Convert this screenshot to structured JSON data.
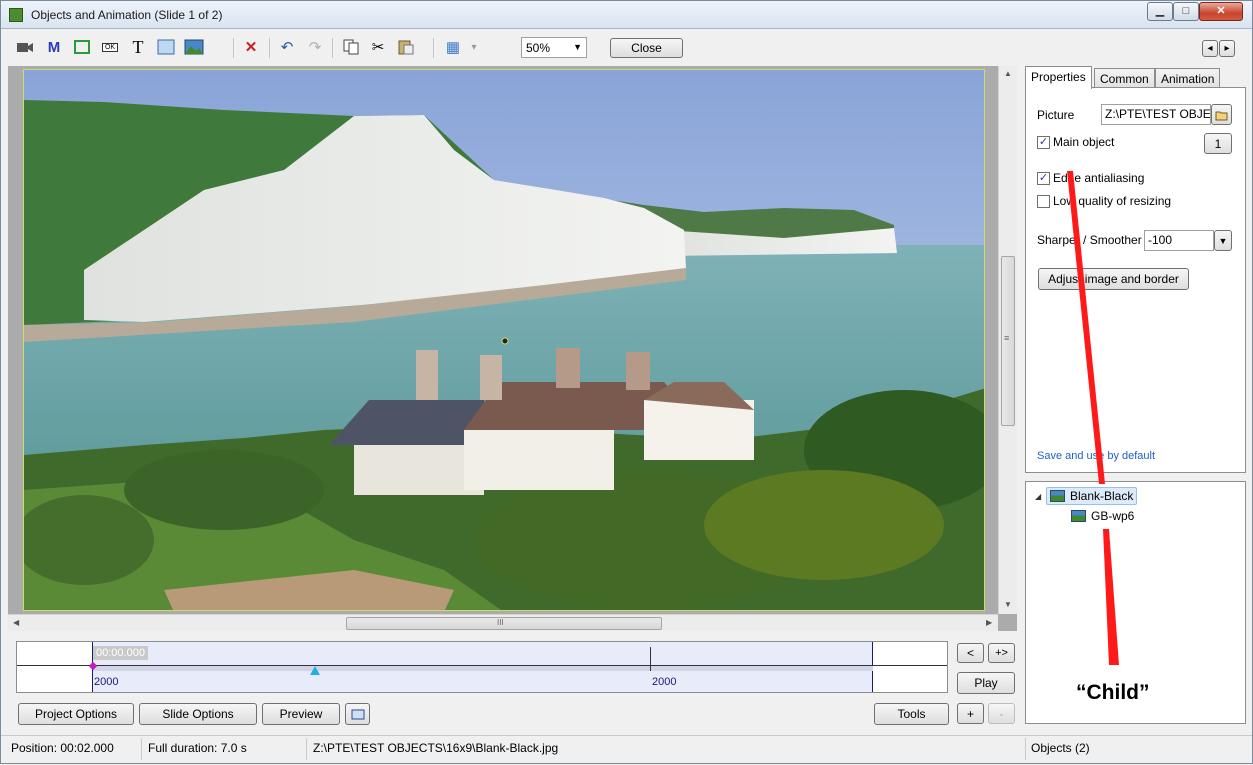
{
  "window": {
    "title": "Objects and Animation  (Slide 1 of 2)",
    "minimize_glyph": "▁",
    "maximize_glyph": "□",
    "close_glyph": "✕"
  },
  "toolbar": {
    "icons": [
      "video-camera-icon",
      "mask-icon",
      "rectangle-frame-icon",
      "button-icon",
      "text-icon",
      "blank-frame-icon",
      "picture-icon",
      "delete-icon",
      "undo-icon",
      "redo-icon",
      "copy-icon",
      "cut-icon",
      "paste-icon",
      "grid-icon"
    ],
    "glyphs": {
      "mask": "M",
      "text": "T",
      "button": "OK",
      "delete": "✕",
      "undo": "↶",
      "redo": "↷",
      "cut": "✂",
      "grid": "▦",
      "grid_dropdown": "▾"
    },
    "zoom_value": "50%",
    "zoom_arrow": "▼",
    "close_label": "Close",
    "nav_prev": "◂",
    "nav_next": "▸"
  },
  "canvas": {
    "scroll_grip": "≡",
    "hscroll_grip": "III",
    "arrow_up": "▲",
    "arrow_down": "▼",
    "arrow_left": "◀",
    "arrow_right": "▶"
  },
  "properties": {
    "tabs": [
      {
        "label": "Properties",
        "active": true
      },
      {
        "label": "Common",
        "active": false
      },
      {
        "label": "Animation",
        "active": false
      }
    ],
    "picture_label": "Picture",
    "picture_path": "Z:\\PTE\\TEST OBJEC",
    "main_object_label": "Main object",
    "main_object_checked": true,
    "main_object_button": "1",
    "edge_antialiasing_label": "Edge antialiasing",
    "edge_antialiasing_checked": true,
    "low_quality_label": "Low quality of resizing",
    "low_quality_checked": false,
    "sharper_label": "Sharper / Smoother",
    "sharper_value": "-100",
    "dropdown_arrow": "▼",
    "check_glyph": "✓",
    "adjust_button": "Adjust image and border",
    "save_link": "Save and use by default"
  },
  "timeline": {
    "time": "00:00.000",
    "label_left": "2000",
    "label_right": "2000"
  },
  "side_buttons": {
    "prev": "<",
    "next": "+>",
    "play": "Play",
    "add": "+",
    "remove": "-"
  },
  "bottom_buttons": {
    "project_options": "Project Options",
    "slide_options": "Slide Options",
    "preview": "Preview",
    "tools": "Tools"
  },
  "tree": {
    "expand_glyph": "◢",
    "items": [
      {
        "label": "Blank-Black",
        "level": 0,
        "selected": true
      },
      {
        "label": "GB-wp6",
        "level": 1,
        "selected": false
      }
    ]
  },
  "annotation": {
    "child_label": "“Child”",
    "color": "#ff0000"
  },
  "status": {
    "position": "Position:  00:02.000",
    "duration": "Full duration:  7.0 s",
    "path": "Z:\\PTE\\TEST OBJECTS\\16x9\\Blank-Black.jpg",
    "objects": "Objects (2)"
  }
}
